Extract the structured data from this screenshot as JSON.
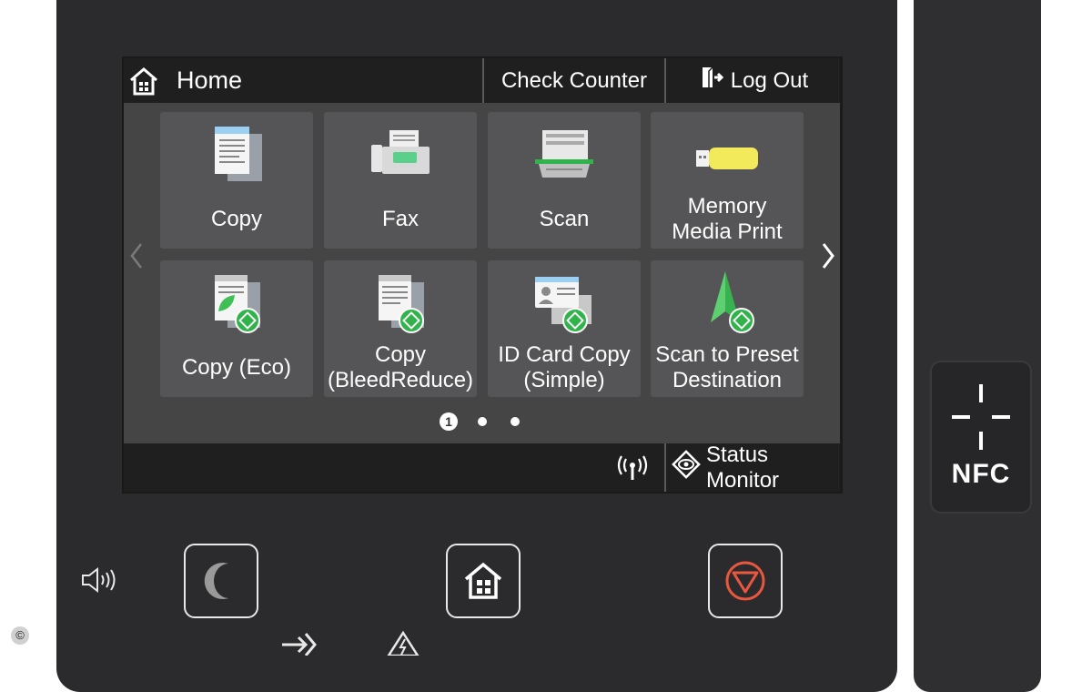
{
  "topbar": {
    "home_label": "Home",
    "check_counter_label": "Check Counter",
    "log_out_label": "Log Out"
  },
  "tiles": [
    {
      "line1": "Copy",
      "line2": "",
      "icon": "copy-icon"
    },
    {
      "line1": "Fax",
      "line2": "",
      "icon": "fax-icon"
    },
    {
      "line1": "Scan",
      "line2": "",
      "icon": "scan-icon"
    },
    {
      "line1": "Memory",
      "line2": "Media Print",
      "icon": "usb-memory-icon"
    },
    {
      "line1": "Copy (Eco)",
      "line2": "",
      "icon": "copy-eco-icon"
    },
    {
      "line1": "Copy",
      "line2": "(BleedReduce)",
      "icon": "copy-bleedreduce-icon"
    },
    {
      "line1": "ID Card Copy",
      "line2": "(Simple)",
      "icon": "id-card-copy-icon"
    },
    {
      "line1": "Scan to Preset",
      "line2": "Destination",
      "icon": "scan-to-preset-icon"
    }
  ],
  "pagination": {
    "current_page": "1",
    "total_pages": 3
  },
  "bottombar": {
    "status_monitor_label": "Status Monitor"
  },
  "nfc": {
    "label": "NFC"
  },
  "copyright": "©",
  "colors": {
    "accent_green": "#2fb34a",
    "stop_red": "#e8573e",
    "usb_yellow": "#f2ea5a"
  }
}
